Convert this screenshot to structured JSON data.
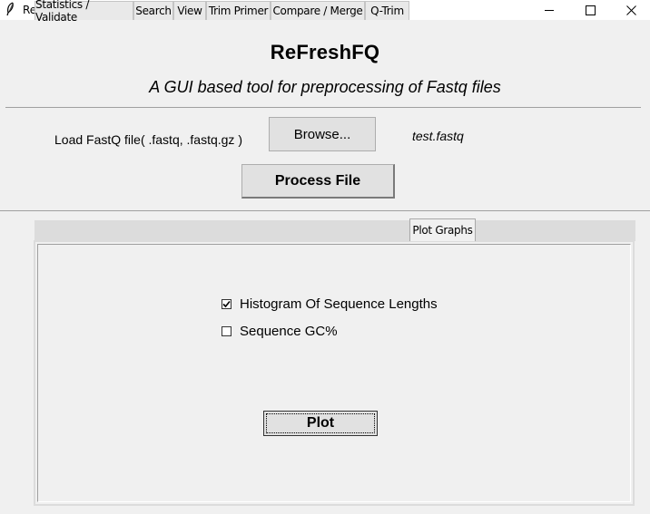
{
  "window": {
    "title": "ReFreshFQ",
    "app_icon": "feather-icon",
    "controls": [
      "minimize-icon",
      "maximize-icon",
      "close-icon"
    ]
  },
  "header": {
    "title": "ReFreshFQ",
    "subtitle": "A GUI based tool for preprocessing of Fastq files"
  },
  "loader": {
    "label": "Load FastQ file( .fastq, .fastq.gz )",
    "browse_label": "Browse...",
    "filename": "test.fastq",
    "process_label": "Process File"
  },
  "tabs": [
    {
      "label": "Statistics / Validate",
      "active": false
    },
    {
      "label": "Search",
      "active": false
    },
    {
      "label": "View",
      "active": false
    },
    {
      "label": "Trim Primer",
      "active": false
    },
    {
      "label": "Compare / Merge",
      "active": false
    },
    {
      "label": "Q-Trim",
      "active": false
    },
    {
      "label": "Plot Graphs",
      "active": true
    }
  ],
  "plot_graphs": {
    "options": [
      {
        "label": "Histogram Of Sequence Lengths",
        "checked": true
      },
      {
        "label": "Sequence GC%",
        "checked": false
      }
    ],
    "plot_label": "Plot"
  }
}
